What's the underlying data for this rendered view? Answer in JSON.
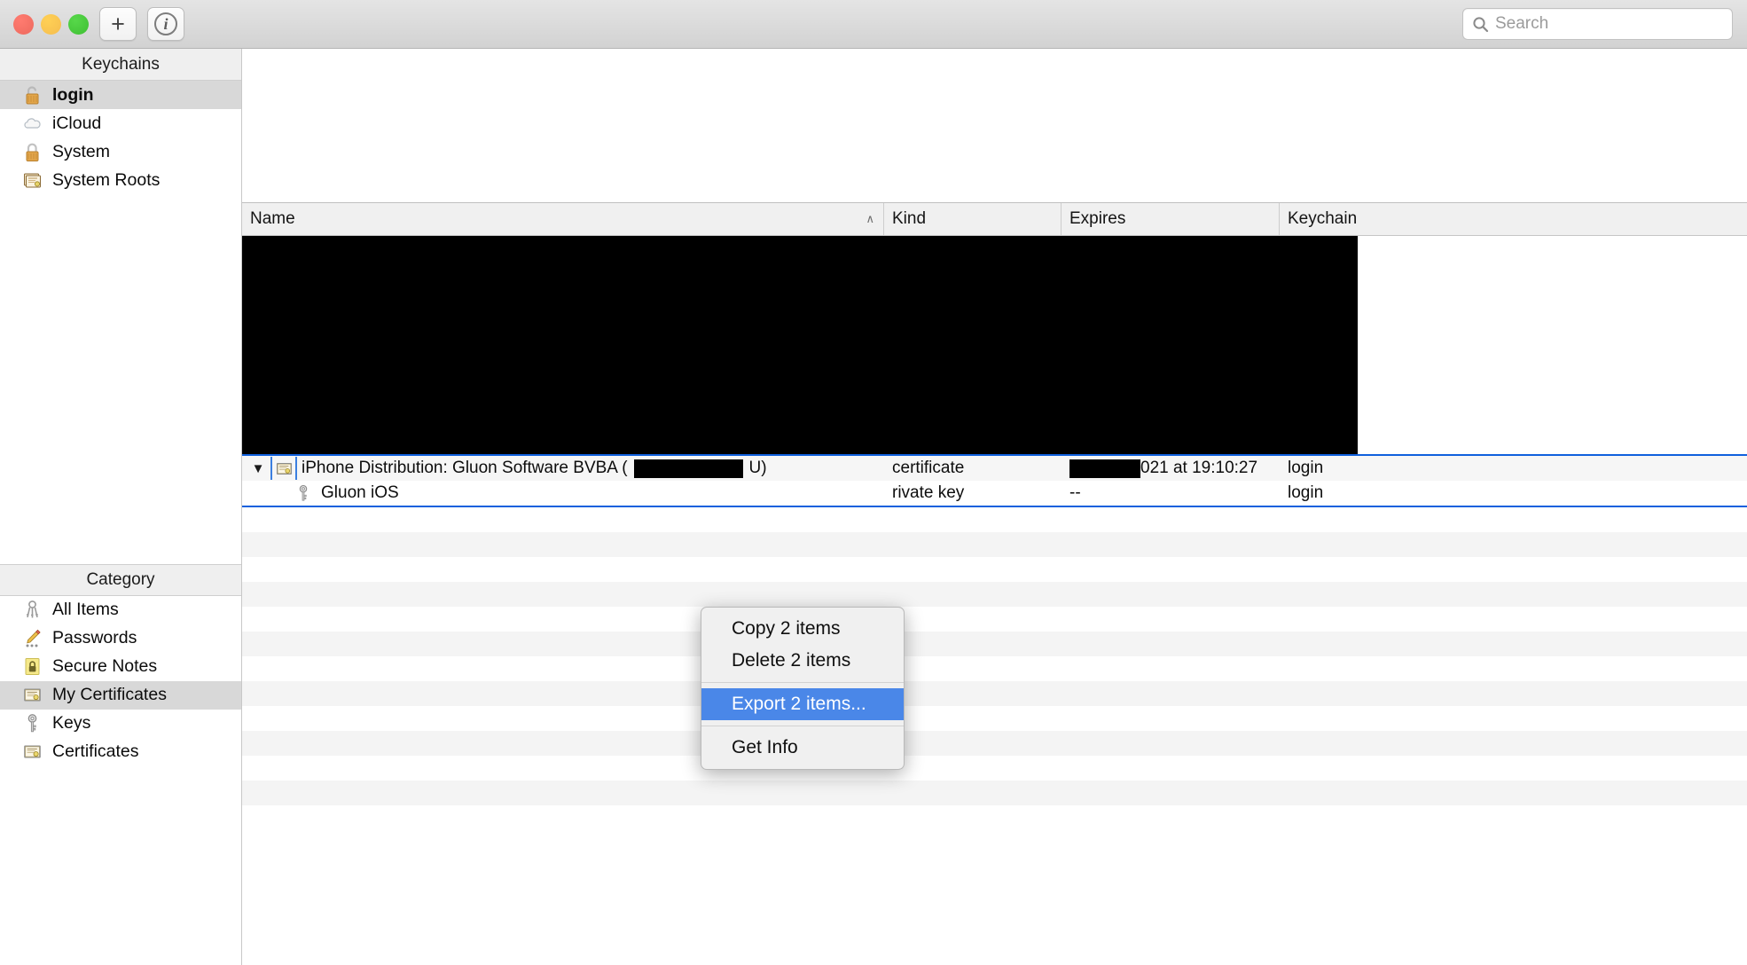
{
  "toolbar": {
    "add_label": "+",
    "info_label": "i",
    "search": {
      "placeholder": "Search",
      "value": ""
    }
  },
  "sidebar": {
    "keychains_header": "Keychains",
    "keychains": [
      {
        "label": "login",
        "icon": "unlocked-padlock-icon",
        "selected": true
      },
      {
        "label": "iCloud",
        "icon": "cloud-icon",
        "selected": false
      },
      {
        "label": "System",
        "icon": "locked-padlock-icon",
        "selected": false
      },
      {
        "label": "System Roots",
        "icon": "certificate-stack-icon",
        "selected": false
      }
    ],
    "category_header": "Category",
    "categories": [
      {
        "label": "All Items",
        "icon": "keyring-icon",
        "selected": false
      },
      {
        "label": "Passwords",
        "icon": "pencil-icon",
        "selected": false
      },
      {
        "label": "Secure Notes",
        "icon": "secure-note-icon",
        "selected": false
      },
      {
        "label": "My Certificates",
        "icon": "certificate-icon",
        "selected": true
      },
      {
        "label": "Keys",
        "icon": "key-icon",
        "selected": false
      },
      {
        "label": "Certificates",
        "icon": "certificate-icon",
        "selected": false
      }
    ]
  },
  "table": {
    "columns": [
      {
        "label": "Name",
        "sort": "ascending",
        "sort_glyph": "∧"
      },
      {
        "label": "Kind",
        "sort": ""
      },
      {
        "label": "Expires",
        "sort": ""
      },
      {
        "label": "Keychain",
        "sort": ""
      }
    ],
    "redacted_block_note": "",
    "rows": [
      {
        "name": "iPhone Distribution: Gluon Software BVBA (",
        "name_suffix": "U)",
        "name_redacted": true,
        "kind": "certificate",
        "expires_prefix_redacted": true,
        "expires": "021 at 19:10:27",
        "keychain": "login",
        "icon": "certificate-icon",
        "disclosure": "▼",
        "selected": true,
        "level": 0
      },
      {
        "name": "Gluon iOS",
        "kind": "rivate key",
        "expires": "--",
        "keychain": "login",
        "icon": "key-icon",
        "selected": true,
        "level": 1
      }
    ]
  },
  "context_menu": {
    "items": [
      {
        "label": "Copy 2 items",
        "highlighted": false,
        "separator_after": false
      },
      {
        "label": "Delete 2 items",
        "highlighted": false,
        "separator_after": true
      },
      {
        "label": "Export 2 items...",
        "highlighted": true,
        "separator_after": true
      },
      {
        "label": "Get Info",
        "highlighted": false,
        "separator_after": false
      }
    ]
  },
  "colors": {
    "selection_blue": "#4a87e8",
    "selection_border": "#1060dd",
    "row_selected_bg": "#d8d8d8",
    "redaction": "#000000"
  }
}
